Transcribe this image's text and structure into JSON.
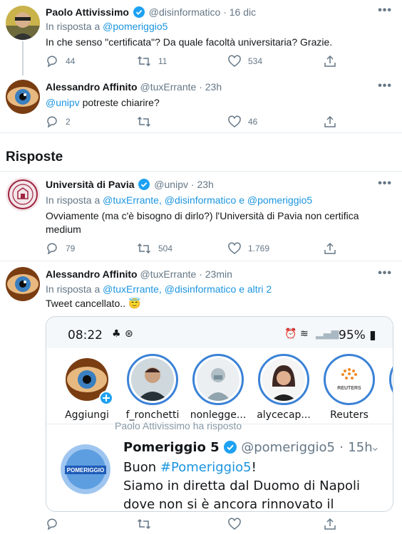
{
  "tweets": [
    {
      "name": "Paolo Attivissimo",
      "handle": "@disinformatico",
      "time": "16 dic",
      "reply_prefix": "In risposta a",
      "reply_to": "@pomeriggio5",
      "text": "In che senso \"certificata\"? Da quale facoltà universitaria? Grazie.",
      "replies": "44",
      "retweets": "11",
      "likes": "534"
    },
    {
      "name": "Alessandro Affinito",
      "handle": "@tuxErrante",
      "time": "23h",
      "mention": "@unipv",
      "text": "potreste chiarire?",
      "replies": "2",
      "retweets": "",
      "likes": "46"
    }
  ],
  "section_title": "Risposte",
  "replies": [
    {
      "name": "Università di Pavia",
      "handle": "@unipv",
      "time": "23h",
      "reply_prefix": "In risposta a",
      "reply_to_1": "@tuxErrante",
      "reply_to_2": "@disinformatico",
      "reply_join": "e",
      "reply_to_3": "@pomeriggio5",
      "text_line1": "Ovviamente (ma c'è bisogno di dirlo?) l'Università di Pavia non certifica",
      "text_line2": "medium",
      "replies": "79",
      "retweets": "504",
      "likes": "1.769"
    },
    {
      "name": "Alessandro Affinito",
      "handle": "@tuxErrante",
      "time": "23min",
      "reply_prefix": "In risposta a",
      "reply_to_1": "@tuxErrante",
      "reply_to_2": "@disinformatico",
      "reply_join": "e altri 2",
      "text": "Tweet cancellato..",
      "emoji": "😇"
    }
  ],
  "phone": {
    "clock": "08:22",
    "battery": "95%",
    "stories": [
      {
        "label": "Aggiungi"
      },
      {
        "label": "f_ronchetti"
      },
      {
        "label": "nonlegge..."
      },
      {
        "label": "alycecap..."
      },
      {
        "label": "Reuters",
        "logo_text": "REUTERS"
      }
    ],
    "ghost_text": "Paolo Attivissimo ha risposto",
    "embed": {
      "logo_text": "POMERIGGIO",
      "name": "Pomeriggio 5",
      "handle": "@pomeriggio5",
      "time": "15h",
      "line1_prefix": "Buon",
      "hashtag": "#Pomeriggio5",
      "line1_suffix": "!",
      "line2": "Siamo in diretta dal Duomo di Napoli",
      "line3": "dove non si è ancora rinnovato il"
    }
  },
  "colors": {
    "link": "#1b95e0",
    "grey": "#657786",
    "verified": "#1da1f2",
    "divider": "#e6ecf0"
  }
}
